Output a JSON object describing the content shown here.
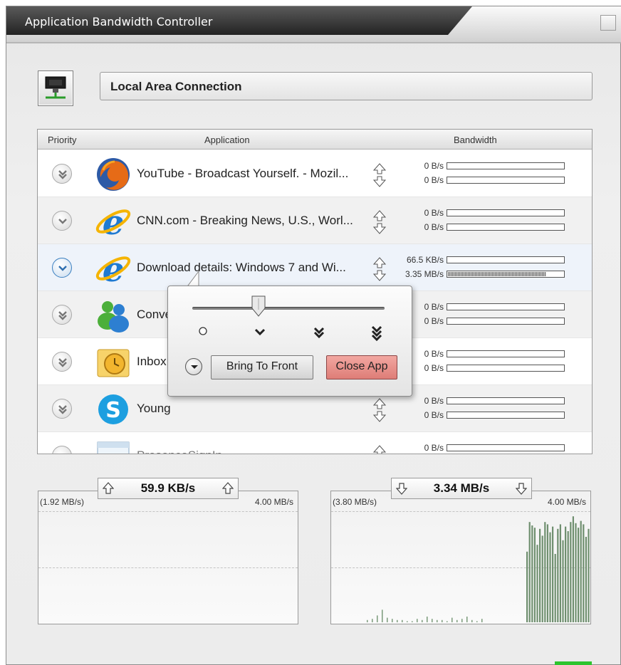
{
  "window": {
    "title": "Application Bandwidth Controller"
  },
  "adapter": {
    "name": "Local Area Connection",
    "icon": "network-adapter-icon"
  },
  "table": {
    "columns": [
      "Priority",
      "Application",
      "Bandwidth"
    ],
    "rows": [
      {
        "priority_icon": "double-chevron-down-icon",
        "app_icon": "firefox-icon",
        "name": "YouTube - Broadcast Yourself. - Mozil...",
        "up": "0 B/s",
        "down": "0 B/s",
        "up_fill": 0,
        "down_fill": 0
      },
      {
        "priority_icon": "chevron-down-icon",
        "app_icon": "internet-explorer-icon",
        "name": "CNN.com - Breaking News, U.S., Worl...",
        "up": "0 B/s",
        "down": "0 B/s",
        "up_fill": 0,
        "down_fill": 0
      },
      {
        "priority_icon": "chevron-down-icon",
        "app_icon": "internet-explorer-icon",
        "name": "Download details: Windows 7 and Wi...",
        "up": "66.5 KB/s",
        "down": "3.35 MB/s",
        "up_fill": 0,
        "down_fill": 0.85
      },
      {
        "priority_icon": "double-chevron-down-icon",
        "app_icon": "messenger-icon",
        "name": "Conve",
        "up": "0 B/s",
        "down": "0 B/s",
        "up_fill": 0,
        "down_fill": 0
      },
      {
        "priority_icon": "double-chevron-down-icon",
        "app_icon": "outlook-icon",
        "name": "Inbox",
        "up": "0 B/s",
        "down": "0 B/s",
        "up_fill": 0,
        "down_fill": 0
      },
      {
        "priority_icon": "double-chevron-down-icon",
        "app_icon": "skype-icon",
        "name": "Young",
        "up": "0 B/s",
        "down": "0 B/s",
        "up_fill": 0,
        "down_fill": 0
      },
      {
        "priority_icon": "chevron-down-icon",
        "app_icon": "window-icon",
        "name": "PresenceSignIn",
        "up": "0 B/s",
        "down": "",
        "up_fill": 0,
        "down_fill": 0
      }
    ]
  },
  "popup": {
    "levels": [
      "none",
      "low",
      "medium",
      "high"
    ],
    "slider_level": "low",
    "bring_to_front": "Bring To Front",
    "close_app": "Close App"
  },
  "upload_graph": {
    "min": "(1.92 MB/s)",
    "current": "59.9 KB/s",
    "max": "4.00 MB/s"
  },
  "download_graph": {
    "min": "(3.80 MB/s)",
    "current": "3.34 MB/s",
    "max": "4.00 MB/s",
    "samples_early": [
      0.02,
      0.03,
      0.06,
      0.11,
      0.04,
      0.03,
      0.02,
      0.02,
      0.01,
      0.01,
      0.03,
      0.02,
      0.05,
      0.03,
      0.02,
      0.02,
      0.01,
      0.04,
      0.02,
      0.03,
      0.05,
      0.02,
      0.01,
      0.03
    ],
    "samples_late": [
      0.62,
      0.88,
      0.85,
      0.83,
      0.68,
      0.82,
      0.76,
      0.88,
      0.86,
      0.79,
      0.84,
      0.6,
      0.82,
      0.86,
      0.72,
      0.84,
      0.8,
      0.88,
      0.93,
      0.87,
      0.83,
      0.89,
      0.86,
      0.75,
      0.82
    ]
  },
  "colors": {
    "title_bar": "#3a3a3a",
    "close_button": "#e2827c",
    "selected_row": "#eef3fa",
    "status": "#2ec42e"
  }
}
